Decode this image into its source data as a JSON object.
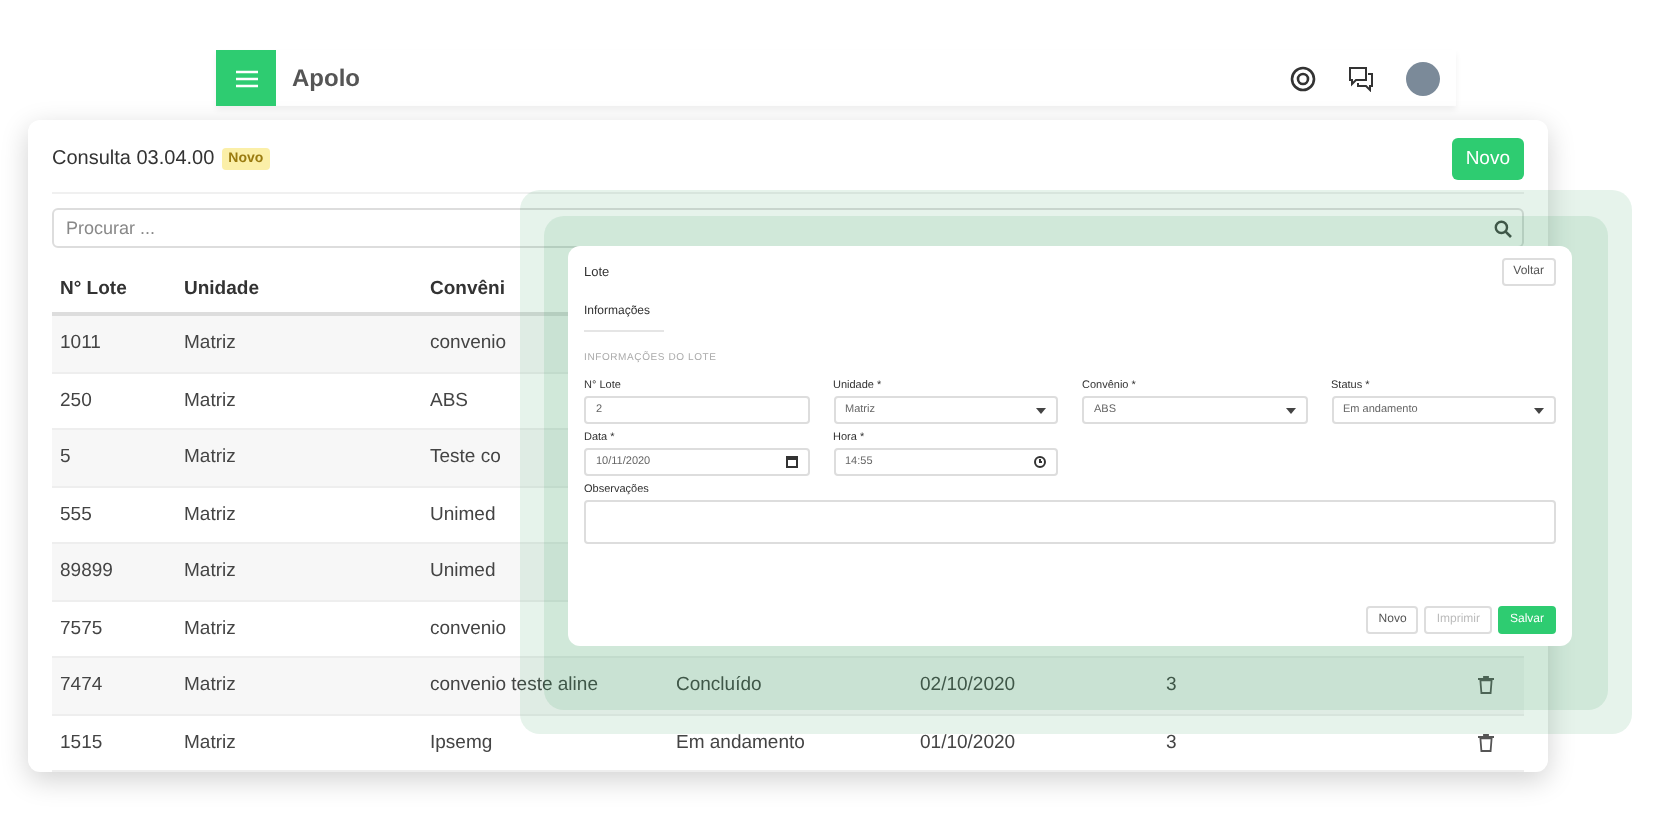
{
  "topbar": {
    "title": "Apolo"
  },
  "card": {
    "title": "Consulta 03.04.00",
    "badge": "Novo",
    "new_button": "Novo",
    "search": {
      "placeholder": "Procurar ..."
    }
  },
  "table": {
    "columns": [
      "N° Lote",
      "Unidade",
      "Convêni"
    ],
    "rows": [
      {
        "cells": [
          "1011",
          "Matriz",
          "convenio"
        ]
      },
      {
        "cells": [
          "250",
          "Matriz",
          "ABS"
        ]
      },
      {
        "cells": [
          "5",
          "Matriz",
          "Teste co"
        ]
      },
      {
        "cells": [
          "555",
          "Matriz",
          "Unimed"
        ]
      },
      {
        "cells": [
          "89899",
          "Matriz",
          "Unimed"
        ]
      },
      {
        "cells": [
          "7575",
          "Matriz",
          "convenio"
        ]
      },
      {
        "cells": [
          "7474",
          "Matriz",
          "convenio teste aline",
          "Concluído",
          "02/10/2020",
          "3"
        ],
        "deletable": true
      },
      {
        "cells": [
          "1515",
          "Matriz",
          "Ipsemg",
          "Em andamento",
          "01/10/2020",
          "3"
        ],
        "deletable": true
      }
    ]
  },
  "modal": {
    "title": "Lote",
    "back_button": "Voltar",
    "tabs": [
      {
        "label": "Informações",
        "selected": true
      }
    ],
    "section": "INFORMAÇÕES DO LOTE",
    "fields": [
      {
        "kind": "text",
        "label": "N° Lote",
        "value": "2"
      },
      {
        "kind": "select",
        "label": "Unidade *",
        "value": "Matriz"
      },
      {
        "kind": "select",
        "label": "Convênio *",
        "value": "ABS"
      },
      {
        "kind": "select",
        "label": "Status *",
        "value": "Em andamento"
      },
      {
        "kind": "date",
        "label": "Data *",
        "value": "10/11/2020"
      },
      {
        "kind": "time",
        "label": "Hora *",
        "value": "14:55"
      },
      {
        "kind": "textarea",
        "label": "Observações"
      }
    ],
    "buttons": [
      {
        "label": "Novo",
        "kind": "default",
        "disabled": false
      },
      {
        "label": "Imprimir",
        "kind": "default",
        "disabled": true
      },
      {
        "label": "Salvar",
        "kind": "primary",
        "disabled": false
      }
    ]
  }
}
